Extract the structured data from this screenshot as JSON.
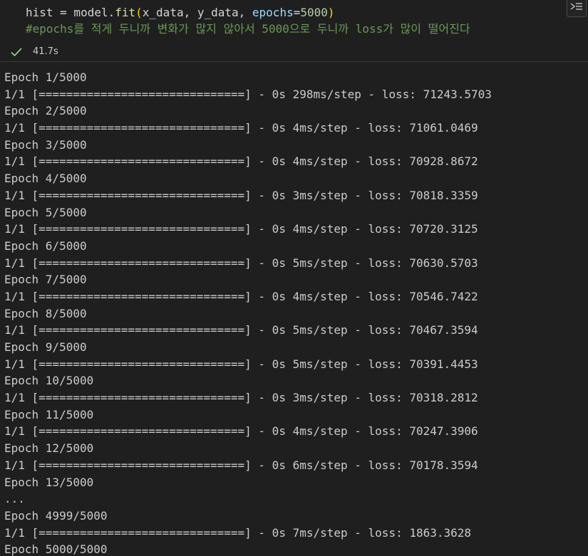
{
  "code": {
    "line1": {
      "var": "hist",
      "assign": " = model.",
      "fn": "fit",
      "open": "(",
      "args": "x_data, y_data, ",
      "kwarg": "epochs",
      "eq": "=",
      "num": "5000",
      "close": ")"
    },
    "line2_comment": "#epochs를 적게 두니까 변화가 많지 않아서 5000으로 두니까 loss가 많이 떨어진다"
  },
  "status": {
    "icon": "check-icon",
    "exec_time": "41.7s"
  },
  "output_lines": [
    "Epoch 1/5000",
    "1/1 [==============================] - 0s 298ms/step - loss: 71243.5703",
    "Epoch 2/5000",
    "1/1 [==============================] - 0s 4ms/step - loss: 71061.0469",
    "Epoch 3/5000",
    "1/1 [==============================] - 0s 4ms/step - loss: 70928.8672",
    "Epoch 4/5000",
    "1/1 [==============================] - 0s 3ms/step - loss: 70818.3359",
    "Epoch 5/5000",
    "1/1 [==============================] - 0s 4ms/step - loss: 70720.3125",
    "Epoch 6/5000",
    "1/1 [==============================] - 0s 5ms/step - loss: 70630.5703",
    "Epoch 7/5000",
    "1/1 [==============================] - 0s 4ms/step - loss: 70546.7422",
    "Epoch 8/5000",
    "1/1 [==============================] - 0s 5ms/step - loss: 70467.3594",
    "Epoch 9/5000",
    "1/1 [==============================] - 0s 5ms/step - loss: 70391.4453",
    "Epoch 10/5000",
    "1/1 [==============================] - 0s 3ms/step - loss: 70318.2812",
    "Epoch 11/5000",
    "1/1 [==============================] - 0s 4ms/step - loss: 70247.3906",
    "Epoch 12/5000",
    "1/1 [==============================] - 0s 6ms/step - loss: 70178.3594",
    "Epoch 13/5000",
    "...",
    "Epoch 4999/5000",
    "1/1 [==============================] - 0s 7ms/step - loss: 1863.3628",
    "Epoch 5000/5000"
  ],
  "colors": {
    "background": "#1f1f1f",
    "comment": "#6a9955",
    "function": "#dcdcaa",
    "number": "#b5cea8",
    "keyword_arg": "#9cdcfe",
    "bracket": "#ffd700",
    "success_check": "#89d185"
  }
}
